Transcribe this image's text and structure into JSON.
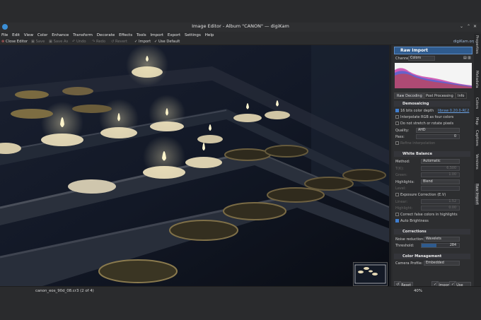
{
  "window": {
    "title": "Image Editor - Album \"CANON\" — digiKam"
  },
  "menu": [
    "File",
    "Edit",
    "View",
    "Color",
    "Enhance",
    "Transform",
    "Decorate",
    "Effects",
    "Tools",
    "Import",
    "Export",
    "Settings",
    "Help"
  ],
  "toolbar": {
    "close": "Close Editor",
    "save": "Save",
    "save_as": "Save As",
    "undo": "Undo",
    "redo": "Redo",
    "revert": "Revert",
    "import": "Import",
    "use_default": "Use Default",
    "brand": "digiKam.org"
  },
  "side_tabs": [
    "Properties",
    "Metadata",
    "Colors",
    "Map",
    "Captions",
    "Versions",
    "Raw Import"
  ],
  "panel": {
    "header": "Raw Import",
    "channel_label": "Channel:",
    "channel_value": "Colors",
    "tabs": [
      "Raw Decoding",
      "Post Processing",
      "Info"
    ],
    "demosaicing": {
      "title": "Demosaicing",
      "bit16": "16 bits color depth",
      "libraw": "libraw 0.20.0-RC2",
      "interpolate": "Interpolate RGB as four colors",
      "nostretch": "Do not stretch or rotate pixels",
      "quality_label": "Quality:",
      "quality_value": "AHD",
      "pass_label": "Pass:",
      "pass_value": "0",
      "refine": "Refine interpolation"
    },
    "white_balance": {
      "title": "White Balance",
      "method_label": "Method:",
      "method_value": "Automatic",
      "t_label": "T(K):",
      "t_value": "6,500",
      "green_label": "Green:",
      "green_value": "1.00",
      "highlights_label": "Highlights:",
      "highlights_value": "Blend",
      "level_label": "Level:",
      "exposure": "Exposure Correction (E.V)",
      "linear_label": "Linear:",
      "linear_value": "1.52",
      "highlight_label": "Highlight:",
      "highlight_value": "0.00",
      "false_colors": "Correct false colors in highlights",
      "auto_brightness": "Auto Brightness"
    },
    "corrections": {
      "title": "Corrections",
      "noise_label": "Noise reduction:",
      "noise_value": "Wavelets",
      "threshold_label": "Threshold:",
      "threshold_value": "284"
    },
    "color_mgmt": {
      "title": "Color Management",
      "camera_label": "Camera Profile:",
      "camera_value": "Embedded"
    },
    "buttons": {
      "reset": "Reset",
      "import": "Import",
      "use_default": "Use Default"
    }
  },
  "status": {
    "filename": "canon_eos_90d_08.cr3 (2 of 4)",
    "zoom": "40%"
  },
  "colors": {
    "accent": "#3b7fd0",
    "panel": "#2d2e30",
    "header": "#2f5b8e"
  }
}
